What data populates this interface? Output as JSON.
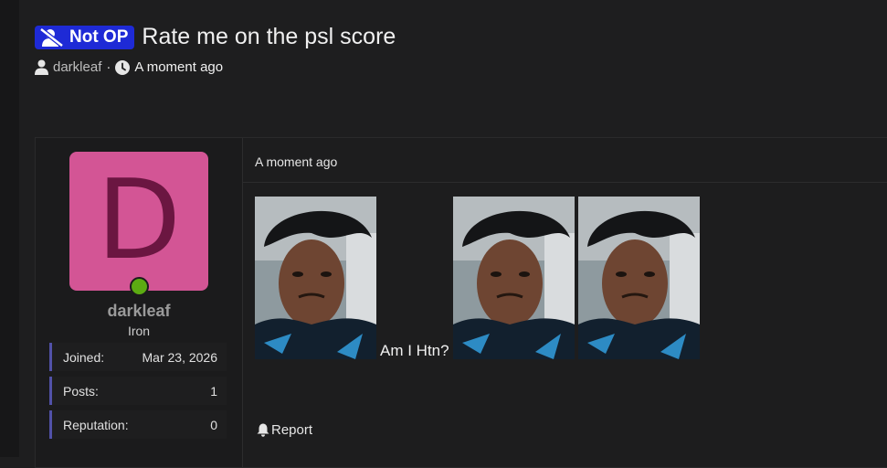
{
  "thread": {
    "badge_label": "Not OP",
    "title": "Rate me on the psl score",
    "author": "darkleaf",
    "separator": "·",
    "time": "A moment ago"
  },
  "post": {
    "date": "A moment ago",
    "caption": "Am I Htn?",
    "report_label": "Report"
  },
  "user": {
    "avatar_letter": "D",
    "username": "darkleaf",
    "rank": "Iron",
    "stats": [
      {
        "label": "Joined:",
        "value": "Mar 23, 2026"
      },
      {
        "label": "Posts:",
        "value": "1"
      },
      {
        "label": "Reputation:",
        "value": "0"
      }
    ]
  },
  "colors": {
    "badge": "#1e2ad6",
    "avatar_bg": "#d35595",
    "avatar_letter": "#6b1641",
    "online": "#5cab12",
    "stat_accent": "#5151a8"
  },
  "icons": [
    "user-slash-icon",
    "user-icon",
    "clock-icon",
    "bell-icon"
  ]
}
